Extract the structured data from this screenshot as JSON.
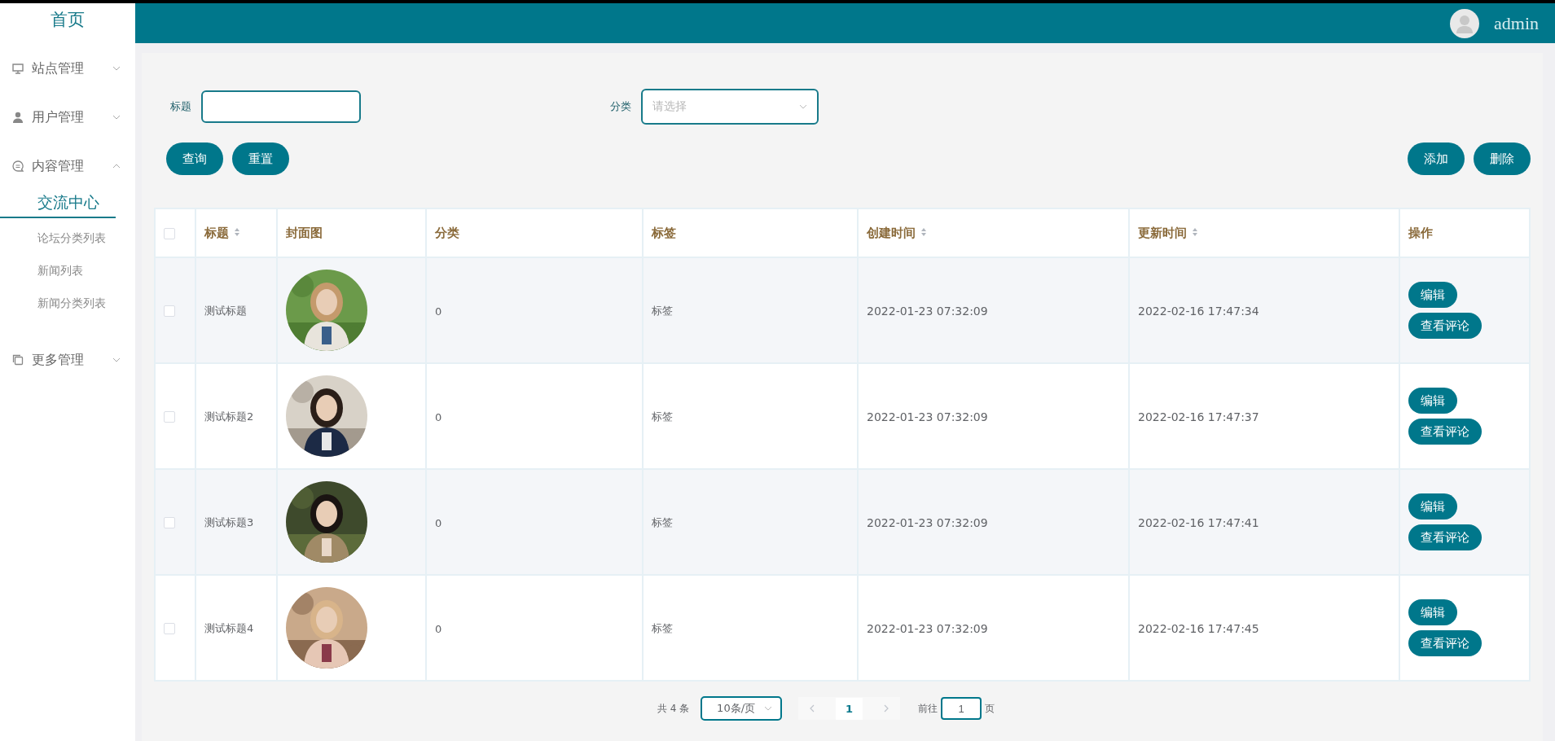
{
  "sidebar": {
    "home": "首页",
    "menus": [
      {
        "label": "站点管理",
        "expanded": false
      },
      {
        "label": "用户管理",
        "expanded": false
      },
      {
        "label": "内容管理",
        "expanded": true,
        "children": [
          {
            "label": "交流中心",
            "selected": true
          },
          {
            "label": "论坛分类列表",
            "selected": false
          },
          {
            "label": "新闻列表",
            "selected": false
          },
          {
            "label": "新闻分类列表",
            "selected": false
          }
        ]
      },
      {
        "label": "更多管理",
        "expanded": false
      }
    ]
  },
  "topbar": {
    "user": "admin"
  },
  "filters": {
    "title_label": "标题",
    "category_label": "分类",
    "category_placeholder": "请选择"
  },
  "actions": {
    "left": [
      "查询",
      "重置"
    ],
    "right": [
      "添加",
      "删除"
    ]
  },
  "table": {
    "select_all_checked": false,
    "columns": [
      {
        "label": "标题",
        "sortable": true
      },
      {
        "label": "封面图",
        "sortable": false
      },
      {
        "label": "分类",
        "sortable": false
      },
      {
        "label": "标签",
        "sortable": false
      },
      {
        "label": "创建时间",
        "sortable": true
      },
      {
        "label": "更新时间",
        "sortable": true
      },
      {
        "label": "操作",
        "sortable": false
      }
    ],
    "rows": [
      {
        "checked": false,
        "title": "测试标题",
        "category": "0",
        "tag": "标签",
        "created": "2022-01-23 07:32:09",
        "updated": "2022-02-16 17:47:34",
        "buttons": [
          "编辑",
          "查看评论"
        ]
      },
      {
        "checked": false,
        "title": "测试标题2",
        "category": "0",
        "tag": "标签",
        "created": "2022-01-23 07:32:09",
        "updated": "2022-02-16 17:47:37",
        "buttons": [
          "编辑",
          "查看评论"
        ]
      },
      {
        "checked": false,
        "title": "测试标题3",
        "category": "0",
        "tag": "标签",
        "created": "2022-01-23 07:32:09",
        "updated": "2022-02-16 17:47:41",
        "buttons": [
          "编辑",
          "查看评论"
        ]
      },
      {
        "checked": false,
        "title": "测试标题4",
        "category": "0",
        "tag": "标签",
        "created": "2022-01-23 07:32:09",
        "updated": "2022-02-16 17:47:45",
        "buttons": [
          "编辑",
          "查看评论"
        ]
      }
    ]
  },
  "pagination": {
    "total": "共 4 条",
    "page_size": "10条/页",
    "pages": [
      {
        "label": "1",
        "selected": true
      }
    ],
    "goto_label": "前往",
    "goto_value": "1",
    "goto_suffix": "页"
  }
}
